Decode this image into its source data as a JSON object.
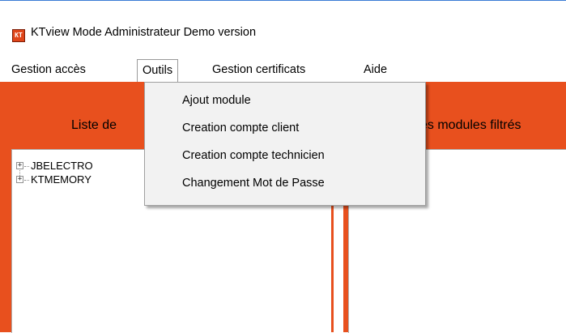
{
  "window": {
    "title": "KTview Mode Administrateur Demo version",
    "icon": "app-icon"
  },
  "menubar": {
    "items": [
      {
        "label": "Gestion accès"
      },
      {
        "label": "Outils",
        "active": true
      },
      {
        "label": "Gestion certificats"
      },
      {
        "label": "Aide"
      }
    ]
  },
  "dropdown": {
    "items": [
      {
        "label": "Ajout module"
      },
      {
        "label": "Creation compte client"
      },
      {
        "label": "Creation compte technicien"
      },
      {
        "label": "Changement Mot de Passe"
      }
    ]
  },
  "left_panel": {
    "label": "Liste de",
    "tree": [
      {
        "label": "JBELECTRO"
      },
      {
        "label": "KTMEMORY"
      }
    ]
  },
  "right_panel": {
    "label": "es modules filtrés"
  },
  "colors": {
    "panel_orange": "#e8501e",
    "menu_bg": "#f2f2f2"
  }
}
